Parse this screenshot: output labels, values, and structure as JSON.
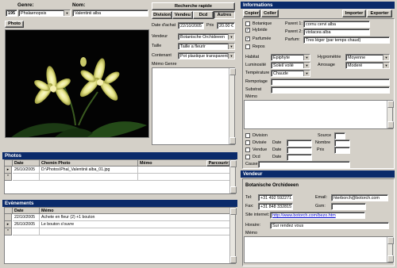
{
  "header": {
    "genre_label": "Genre:",
    "nom_label": "Nom:",
    "number": "195",
    "genre_value": "Phalaenopsis",
    "nom_value": "Valentinii alba",
    "search_button": "Recherche rapide",
    "tabs": [
      "Division",
      "Vendeu",
      "Dcd",
      "Autres"
    ],
    "photo_tab": "Photo"
  },
  "details": {
    "date_achat_label": "Date d'achat",
    "date_achat": "22/10/2005",
    "prix_label": "Prix",
    "prix": "20.00 €",
    "vendeur_label": "Vendeur",
    "vendeur": "Botanische Orchideeen",
    "taille_label": "Taille",
    "taille": "Taille a fleurir",
    "contenant_label": "Contenant",
    "contenant": "Pot plastique transparent",
    "memo_genre_label": "Mémo Genre"
  },
  "photos": {
    "title": "Photos",
    "columns": [
      "Date",
      "Chemin Photo",
      "Mémo"
    ],
    "browse_button": "Parcourir",
    "rows": [
      {
        "date": "26/10/2005",
        "path": "D:\\Photos\\Phal_Valentinii alba_01.jpg",
        "memo": ""
      }
    ]
  },
  "events": {
    "title": "Evènements",
    "columns": [
      "Date",
      "Mémo"
    ],
    "rows": [
      {
        "date": "22/10/2005",
        "memo": "Achete en fleur (2) +1 bouton"
      },
      {
        "date": "26/10/2005",
        "memo": "Le bouton s'ouvre"
      }
    ]
  },
  "info": {
    "title": "Informations",
    "copy_button": "Copier",
    "paste_button": "Coller",
    "import_button": "Importer",
    "export_button": "Exporter",
    "botanique_label": "Botanique",
    "hybride_label": "Hybride",
    "parfumee_label": "Parfumée",
    "repos_label": "Repos",
    "parent1_label": "Parent 1:",
    "parent1": "cornu cervi alba",
    "parent2_label": "Parent 2:",
    "parent2": "violacea alba",
    "parfum_label": "Parfum:",
    "parfum": "Tres léger (par temps chaud)",
    "habitat_label": "Habitat",
    "habitat": "Epiphyte",
    "hygrometrie_label": "Hygrométrie",
    "hygrometrie": "Moyenne",
    "luminosite_label": "Luminosité",
    "luminosite": "Soleil voilé",
    "arrosage_label": "Arrosage",
    "arrosage": "Moderé",
    "temperature_label": "Température",
    "temperature": "Chaude",
    "rempotage_label": "Rempotage",
    "substrat_label": "Substrat",
    "memo_label": "Mémo",
    "division_label": "Division",
    "divisee_label": "Divisée",
    "vendue_label": "Vendue",
    "dcd_label": "Dcd",
    "date_label": "Date",
    "source_label": "Source",
    "nombre_label": "Nombre",
    "prix_label": "Prix",
    "cause_label": "Cause"
  },
  "vendeur": {
    "title": "Vendeur",
    "name": "Botanische Orchideeen",
    "tel_label": "Tel:",
    "tel": "+31 492 592271",
    "fax_label": "Fax:",
    "fax": "+31 848 332815",
    "email_label": "Email:",
    "email": "hterborch@botorch.com",
    "gsm_label": "Gsm:",
    "site_label": "Site internet:",
    "site": "http://www.botorch.com/bezo.htm",
    "horaire_label": "Horaire:",
    "horaire": "Sur rendez vous",
    "memo_label": "Mémo"
  }
}
